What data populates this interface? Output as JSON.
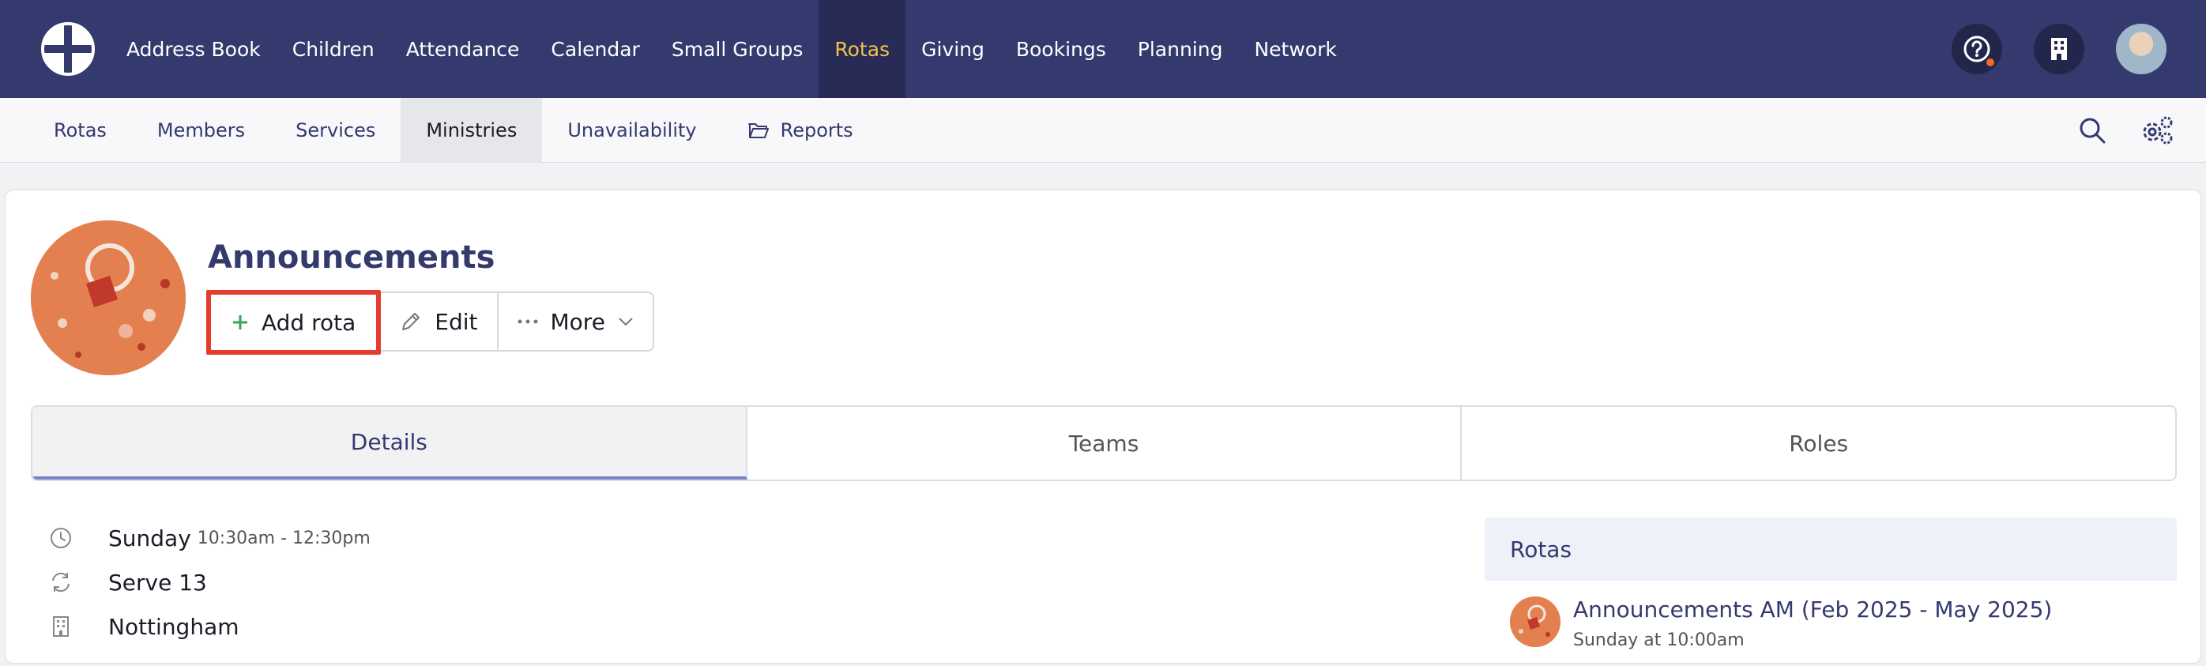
{
  "topnav": {
    "items": [
      {
        "label": "Address Book"
      },
      {
        "label": "Children"
      },
      {
        "label": "Attendance"
      },
      {
        "label": "Calendar"
      },
      {
        "label": "Small Groups"
      },
      {
        "label": "Rotas"
      },
      {
        "label": "Giving"
      },
      {
        "label": "Bookings"
      },
      {
        "label": "Planning"
      },
      {
        "label": "Network"
      }
    ],
    "active_color": "#f2c34a",
    "bg_color": "#343a6e"
  },
  "subnav": {
    "items": [
      {
        "label": "Rotas"
      },
      {
        "label": "Members"
      },
      {
        "label": "Services"
      },
      {
        "label": "Ministries"
      },
      {
        "label": "Unavailability"
      },
      {
        "label": "Reports"
      }
    ]
  },
  "ministry": {
    "title": "Announcements",
    "actions": {
      "add_label": "Add rota",
      "edit_label": "Edit",
      "more_label": "More"
    }
  },
  "tabs": [
    {
      "label": "Details"
    },
    {
      "label": "Teams"
    },
    {
      "label": "Roles"
    }
  ],
  "details": {
    "day": "Sunday",
    "time": "10:30am - 12:30pm",
    "frequency": "Serve 13",
    "location": "Nottingham"
  },
  "rotas_panel": {
    "heading": "Rotas",
    "items": [
      {
        "name": "Announcements AM (Feb 2025 - May 2025)",
        "schedule": "Sunday at 10:00am"
      }
    ]
  },
  "accent": {
    "highlight_border": "#e43d2b",
    "add_icon": "#3aa55a"
  }
}
